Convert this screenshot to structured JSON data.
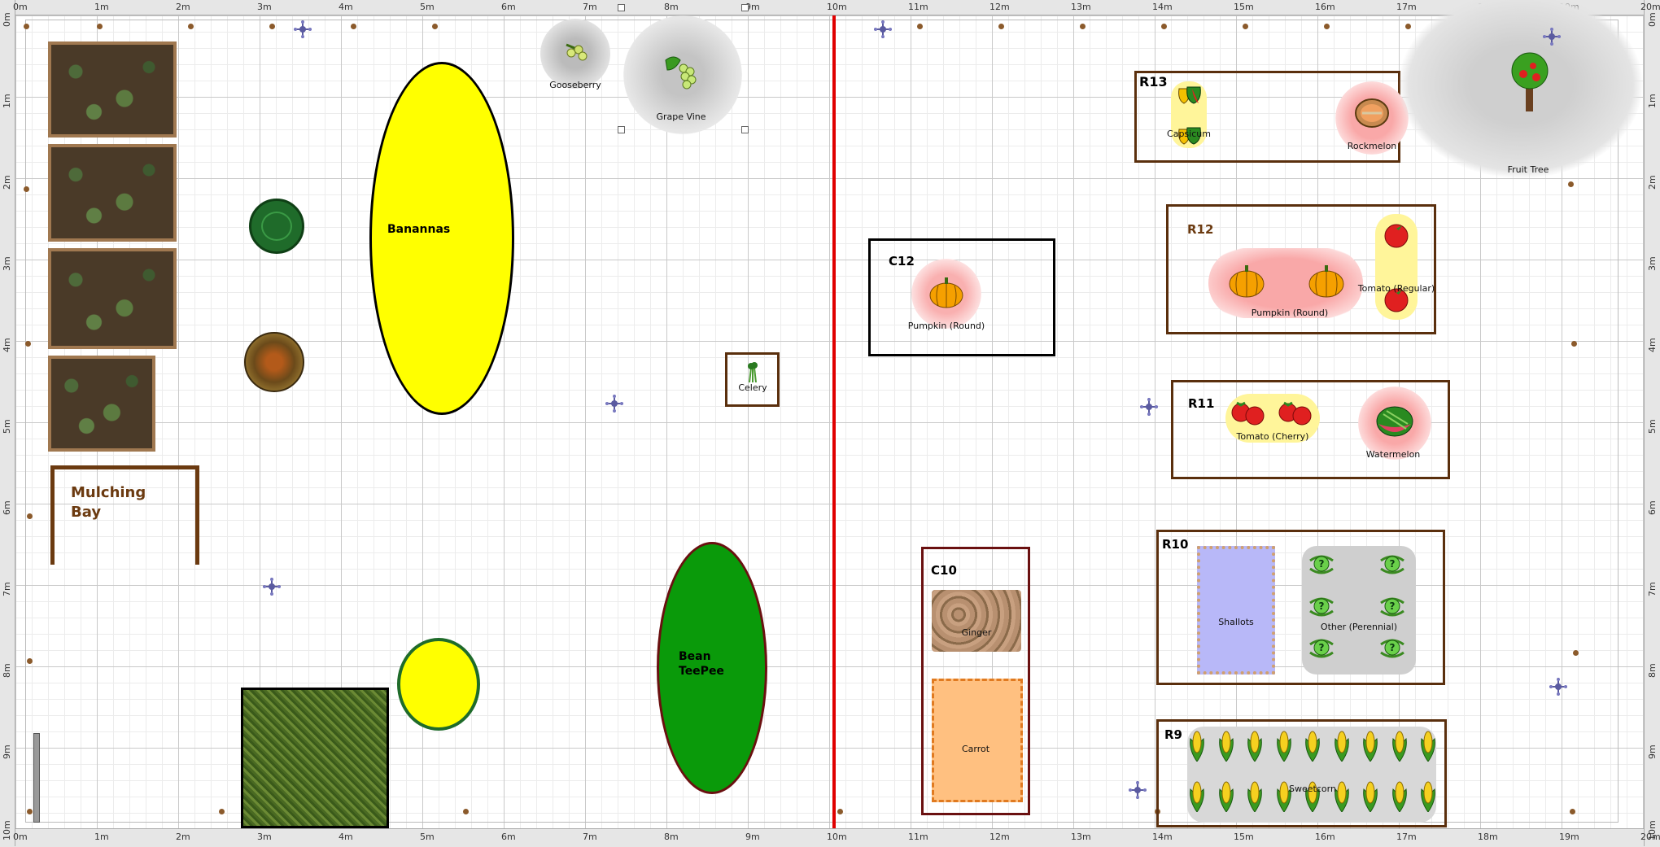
{
  "ruler": {
    "x_labels": [
      "0m",
      "1m",
      "2m",
      "3m",
      "4m",
      "5m",
      "6m",
      "7m",
      "8m",
      "9m",
      "10m",
      "11m",
      "12m",
      "13m",
      "14m",
      "15m",
      "16m",
      "17m",
      "18m",
      "19m",
      "20m"
    ],
    "y_labels": [
      "0m",
      "1m",
      "2m",
      "3m",
      "4m",
      "5m",
      "6m",
      "7m",
      "8m",
      "9m",
      "10m"
    ]
  },
  "beds": {
    "r13": "R13",
    "r12": "R12",
    "r11": "R11",
    "r10": "R10",
    "r9": "R9",
    "c12": "C12",
    "c10": "C10"
  },
  "areas": {
    "mulching_bay_line1": "Mulching",
    "mulching_bay_line2": "Bay",
    "bananas": "Banannas",
    "bean_teepee_line1": "Bean",
    "bean_teepee_line2": "TeePee"
  },
  "plants": {
    "gooseberry": "Gooseberry",
    "grape_vine": "Grape Vine",
    "celery": "Celery",
    "pumpkin_c12": "Pumpkin (Round)",
    "ginger": "Ginger",
    "carrot": "Carrot",
    "capsicum": "Capsicum",
    "rockmelon": "Rockmelon",
    "fruit_tree": "Fruit Tree",
    "pumpkin_r12": "Pumpkin (Round)",
    "tomato_regular": "Tomato (Regular)",
    "tomato_cherry": "Tomato (Cherry)",
    "watermelon": "Watermelon",
    "shallots": "Shallots",
    "other_perennial": "Other (Perennial)",
    "sweetcorn": "Sweetcorn"
  },
  "colors": {
    "bed_border": "#5a2f0d",
    "boundary_line": "#e00000",
    "banana_fill": "#ffff00",
    "bean_fill": "#0a9a0a"
  }
}
